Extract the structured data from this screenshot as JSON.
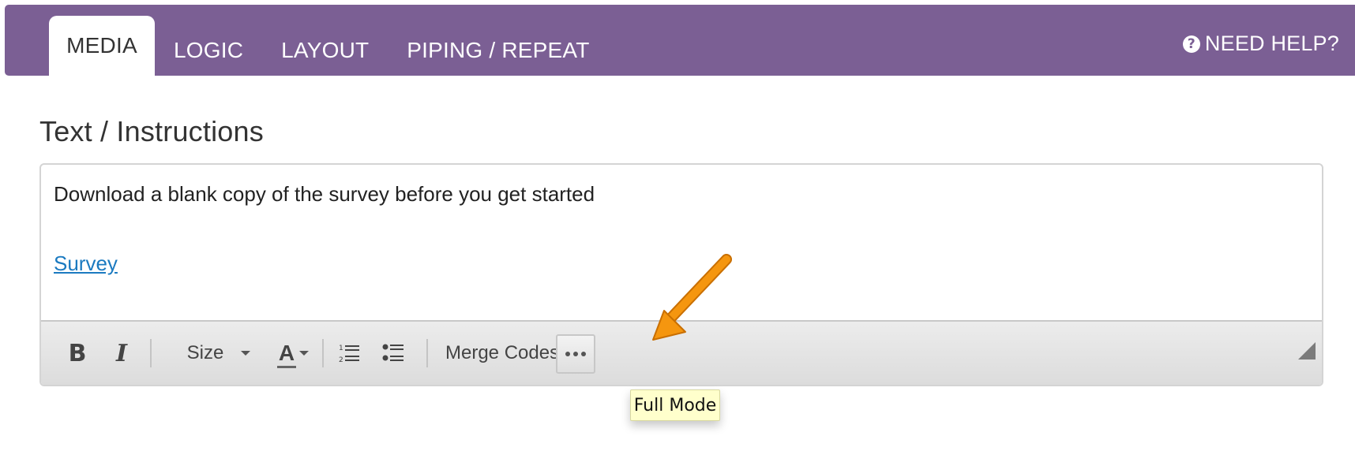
{
  "tabs": [
    {
      "label": "MEDIA",
      "active": true
    },
    {
      "label": "LOGIC",
      "active": false
    },
    {
      "label": "LAYOUT",
      "active": false
    },
    {
      "label": "PIPING / REPEAT",
      "active": false
    }
  ],
  "help": {
    "label": "NEED HELP?",
    "icon": "question-circle-icon"
  },
  "section": {
    "title": "Text / Instructions"
  },
  "editor": {
    "paragraph": "Download a blank copy of the survey before you get started",
    "link_text": "Survey",
    "toolbar": {
      "bold_label": "B",
      "italic_label": "I",
      "size_label": "Size",
      "color_label": "A",
      "merge_codes_label": "Merge Codes",
      "full_mode_icon": "ellipsis-icon"
    }
  },
  "tooltip": {
    "text": "Full Mode"
  },
  "colors": {
    "brand_purple": "#7b5f94",
    "link_blue": "#1b7ac0",
    "annotation_orange": "#f5960f",
    "tooltip_bg": "#ffffcc"
  }
}
